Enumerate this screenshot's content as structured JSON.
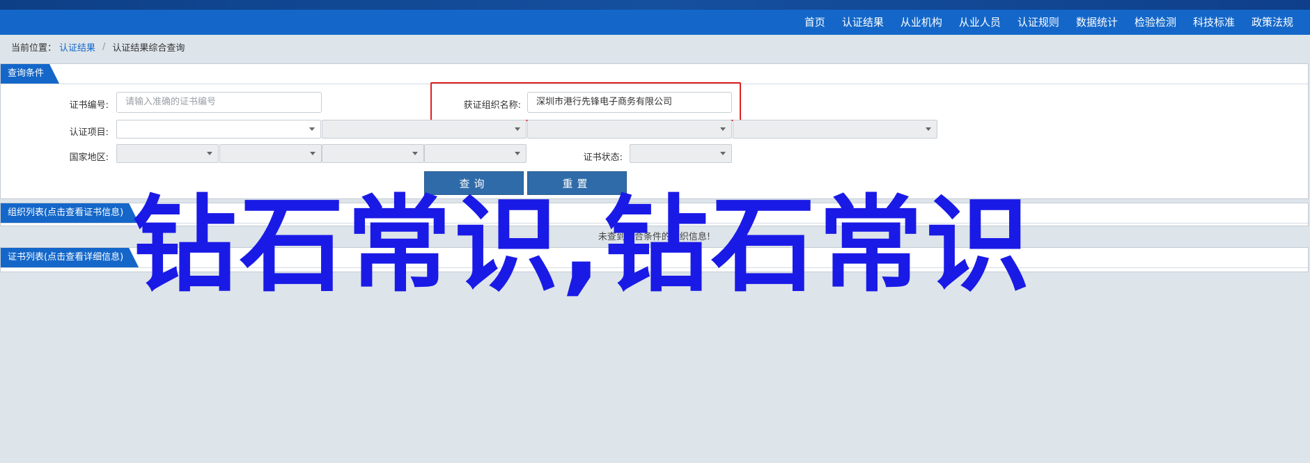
{
  "nav": {
    "items": [
      "首页",
      "认证结果",
      "从业机构",
      "从业人员",
      "认证规则",
      "数据统计",
      "检验检测",
      "科技标准",
      "政策法规"
    ]
  },
  "breadcrumb": {
    "prefix": "当前位置：",
    "link": "认证结果",
    "separator": "/",
    "current": "认证结果综合查询"
  },
  "query_panel": {
    "title": "查询条件",
    "cert_no_label": "证书编号:",
    "cert_no_placeholder": "请输入准确的证书编号",
    "org_name_label": "获证组织名称:",
    "org_name_value": "深圳市港行先锋电子商务有限公司",
    "project_label": "认证项目:",
    "region_label": "国家地区:",
    "status_label": "证书状态:",
    "query_button": "查询",
    "reset_button": "重置"
  },
  "org_panel": {
    "title": "组织列表(点击查看证书信息)",
    "empty_message": "未查到符合条件的组织信息!"
  },
  "cert_panel": {
    "title": "证书列表(点击查看详细信息)"
  },
  "overlay": {
    "text": "钻石常识,钻石常识"
  },
  "colors": {
    "nav_bg": "#1467c9",
    "button_bg": "#2f6ba8",
    "highlight": "#e02020",
    "overlay_text": "#1a1ae6"
  }
}
